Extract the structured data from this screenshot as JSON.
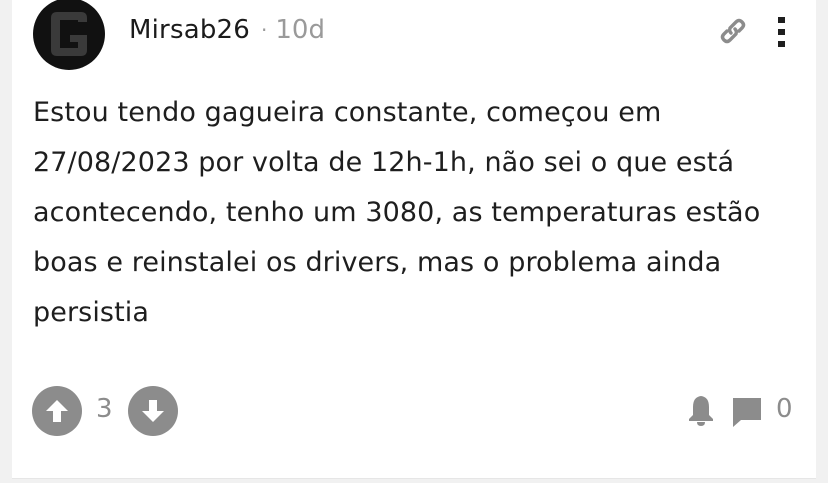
{
  "post": {
    "author": "Mirsab26",
    "separator": "·",
    "age": "10d",
    "body": "Estou tendo gagueira constante, começou em 27/08/2023 por volta de 12h-1h, não sei o que está acontecendo, tenho um 3080, as temperaturas estão boas e reinstalei os drivers, mas o problema ainda persistia"
  },
  "icons": {
    "avatar": "avatar-letter-g",
    "link": "link-icon",
    "more": "more-vertical-icon",
    "upvote": "arrow-up-icon",
    "downvote": "arrow-down-icon",
    "notify": "bell-icon",
    "comment": "comment-icon"
  },
  "footer": {
    "vote_count": "3",
    "comment_count": "0"
  },
  "colors": {
    "icon_gray": "#8c8c8c",
    "text_dark": "#1e1e1e",
    "text_muted": "#9a9a9a",
    "avatar_bg": "#111111"
  }
}
